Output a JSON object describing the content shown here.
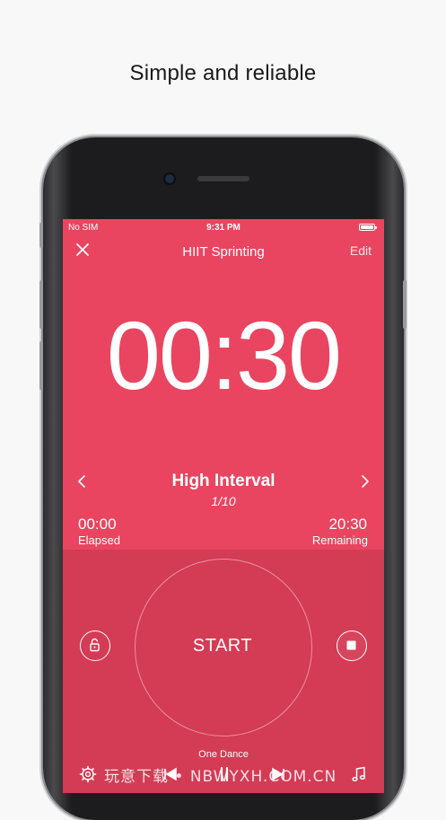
{
  "headline": "Simple and reliable",
  "status_bar": {
    "carrier": "No SIM",
    "time": "9:31 PM"
  },
  "nav": {
    "title": "HIIT Sprinting",
    "edit_label": "Edit"
  },
  "timer": {
    "countdown": "00:30"
  },
  "interval": {
    "name": "High Interval",
    "count": "1/10"
  },
  "elapsed": {
    "value": "00:00",
    "label": "Elapsed"
  },
  "remaining": {
    "value": "20:30",
    "label": "Remaining"
  },
  "controls": {
    "start_label": "START"
  },
  "music": {
    "song_title": "One Dance"
  },
  "watermark": "玩意下载 • NBWYXH.COM.CN",
  "colors": {
    "screen_top": "#e94560",
    "screen_bottom": "#d43b54",
    "page_background": "#f8f8f8"
  },
  "icons": [
    "close-icon",
    "chevron-left-icon",
    "chevron-right-icon",
    "lock-icon",
    "stop-icon",
    "settings-icon",
    "rewind-icon",
    "pause-icon",
    "forward-icon",
    "music-note-icon",
    "battery-icon"
  ]
}
